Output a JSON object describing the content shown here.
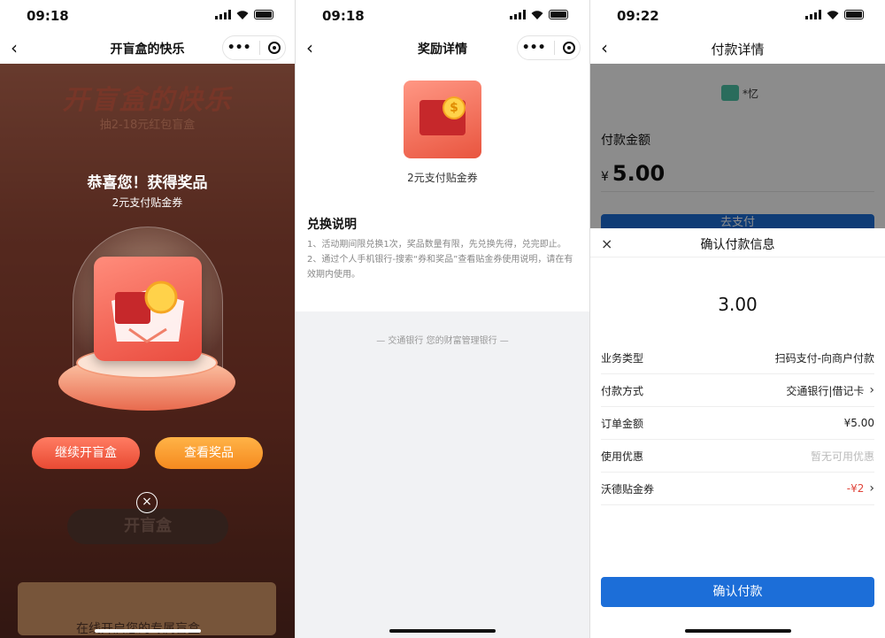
{
  "panel1": {
    "time": "09:18",
    "nav_title": "开盲盒的快乐",
    "capsule_more": "•••",
    "banner_title": "开盲盒的快乐",
    "banner_sub": "抽2-18元红包盲盒",
    "congrats": "恭喜您！获得奖品",
    "prize_name": "2元支付贴金券",
    "continue_label": "继续开盲盒",
    "view_label": "查看奖品",
    "close_symbol": "×",
    "under_button": "开盲盒",
    "under_bottom_text": "在线开启您的专属盲盒"
  },
  "panel2": {
    "time": "09:18",
    "nav_title": "奖励详情",
    "capsule_more": "•••",
    "reward_label": "2元支付贴金券",
    "coin_glyph": "$",
    "section_title": "兑换说明",
    "rule_1": "1、活动期间限兑换1次，奖品数量有限，先兑换先得，兑完即止。",
    "rule_2": "2、通过个人手机银行-搜索“券和奖品”查看贴金券使用说明，请在有效期内使用。",
    "footer": "— 交通银行 您的财富管理银行 —"
  },
  "panel3": {
    "time": "09:22",
    "nav_title": "付款详情",
    "shop_name": "*忆",
    "amount_label": "付款金额",
    "currency": "¥",
    "amount": "5.00",
    "pay_under_label": "去支付",
    "sheet_close": "×",
    "sheet_title": "确认付款信息",
    "sheet_amount": "3.00",
    "rows": [
      {
        "label": "业务类型",
        "value": "扫码支付-向商户付款"
      },
      {
        "label": "付款方式",
        "value": "交通银行|借记卡"
      },
      {
        "label": "订单金额",
        "value": "¥5.00"
      },
      {
        "label": "使用优惠",
        "value": "暂无可用优惠"
      },
      {
        "label": "沃德贴金券",
        "value": "-¥2"
      }
    ],
    "confirm_label": "确认付款",
    "accent": "#1c6ed8"
  }
}
